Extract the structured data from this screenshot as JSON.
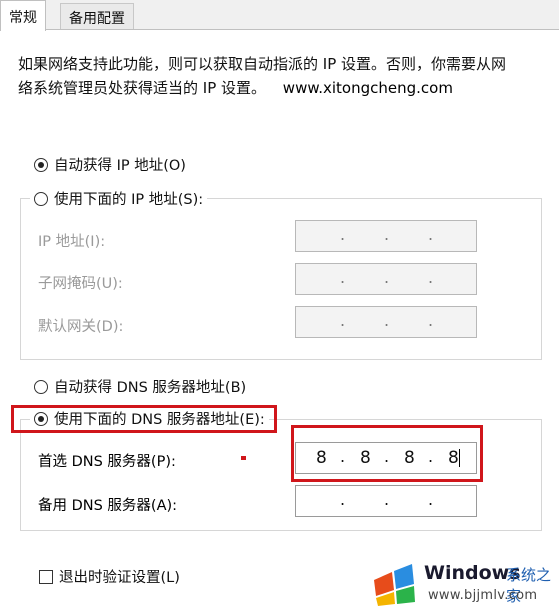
{
  "tabs": [
    {
      "label": "常规",
      "active": true
    },
    {
      "label": "备用配置",
      "active": false
    }
  ],
  "description": {
    "line1": "如果网络支持此功能，则可以获取自动指派的 IP 设置。否则，你需要从网",
    "line2": "络系统管理员处获得适当的 IP 设置。",
    "watermark": "www.xitongcheng.com"
  },
  "ip_section": {
    "auto_option": {
      "label": "自动获得 IP 地址(O)",
      "checked": true
    },
    "manual_option": {
      "label": "使用下面的 IP 地址(S):",
      "checked": false
    },
    "fields": [
      {
        "label": "IP 地址(I):",
        "value": ". . ."
      },
      {
        "label": "子网掩码(U):",
        "value": ". . ."
      },
      {
        "label": "默认网关(D):",
        "value": ". . ."
      }
    ]
  },
  "dns_section": {
    "auto_option": {
      "label": "自动获得 DNS 服务器地址(B)",
      "checked": false
    },
    "manual_option": {
      "label": "使用下面的 DNS 服务器地址(E):",
      "checked": true
    },
    "preferred": {
      "label": "首选 DNS 服务器(P):",
      "octets": [
        "8",
        "8",
        "8",
        "8"
      ]
    },
    "alternate": {
      "label": "备用 DNS 服务器(A):",
      "octets": [
        "",
        "",
        "",
        ""
      ]
    }
  },
  "validate": {
    "label": "退出时验证设置(L)",
    "checked": false
  },
  "watermark_logo": {
    "brand": "Windows",
    "cn": "系统之家",
    "url": "www.bjjmlv.com"
  },
  "colors": {
    "highlight": "#d0161b",
    "panel": "#ffffff",
    "tabbar": "#f0f0f0"
  }
}
